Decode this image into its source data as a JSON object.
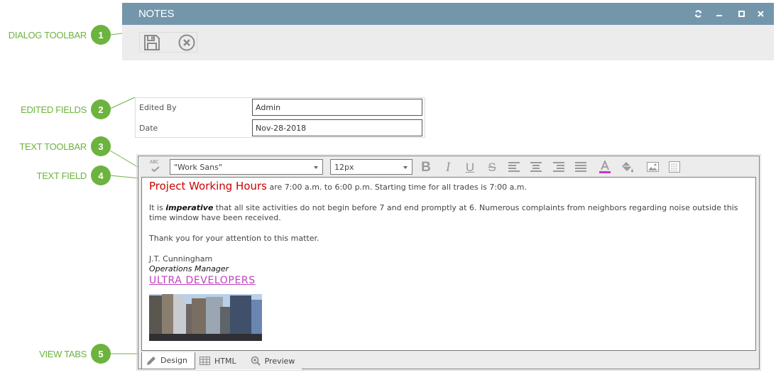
{
  "callouts": [
    {
      "number": "1",
      "label": "DIALOG TOOLBAR"
    },
    {
      "number": "2",
      "label": "EDITED FIELDS"
    },
    {
      "number": "3",
      "label": "TEXT TOOLBAR"
    },
    {
      "number": "4",
      "label": "TEXT FIELD"
    },
    {
      "number": "5",
      "label": "VIEW TABS"
    }
  ],
  "dialog": {
    "title": "NOTES",
    "window_controls": [
      "refresh-icon",
      "minimize-icon",
      "maximize-icon",
      "close-icon"
    ],
    "toolbar": {
      "buttons": [
        {
          "name": "save",
          "icon": "save-icon"
        },
        {
          "name": "cancel",
          "icon": "cancel-icon"
        }
      ]
    }
  },
  "fields": [
    {
      "label": "Edited By",
      "value": "Admin"
    },
    {
      "label": "Date",
      "value": "Nov-28-2018"
    }
  ],
  "text_toolbar": {
    "spellcheck_label": "ABC",
    "font_family": "\"Work Sans\"",
    "font_size": "12px",
    "buttons": [
      "bold",
      "italic",
      "underline",
      "strikethrough",
      "align-left",
      "align-center",
      "align-right",
      "justify",
      "font-color",
      "background-color",
      "insert-image",
      "insert-table"
    ],
    "font_color_accent": "#cc33cc"
  },
  "content": {
    "headline": "Project Working Hours",
    "line1_rest": " are 7:00 a.m. to 6:00 p.m. Starting time for all trades is 7:00 a.m.",
    "para2_pre": "It is ",
    "para2_emph": "imperative",
    "para2_post": " that all site activities do not begin before 7 and end promptly at 6. Numerous complaints from neighbors regarding noise outside this time window have been received.",
    "para3": "Thank you for your attention to this matter.",
    "signature_name": "J.T. Cunningham",
    "signature_role": "Operations Manager",
    "company_link": "ULTRA DEVELOPERS",
    "image_alt": "city skyline photo"
  },
  "view_tabs": [
    {
      "label": "Design",
      "icon": "pencil-icon",
      "active": true
    },
    {
      "label": "HTML",
      "icon": "table-icon",
      "active": false
    },
    {
      "label": "Preview",
      "icon": "zoom-in-icon",
      "active": false
    }
  ],
  "colors": {
    "header": "#7396ab",
    "callout": "#6cb33f",
    "headline": "#cc0000",
    "link": "#c040c0"
  }
}
